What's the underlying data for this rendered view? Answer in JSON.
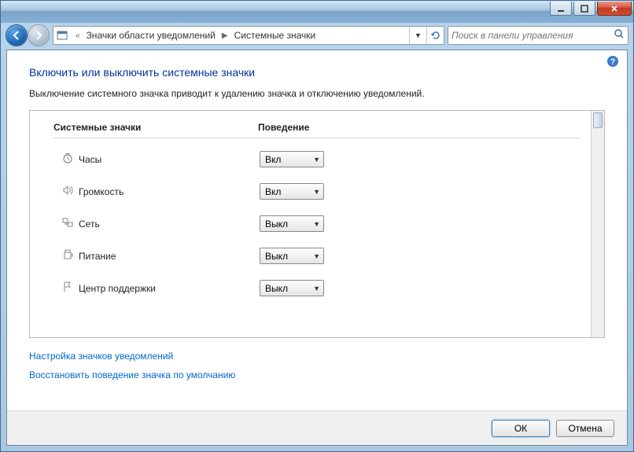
{
  "window": {
    "breadcrumb_prefix": "«",
    "breadcrumb_1": "Значки области уведомлений",
    "breadcrumb_2": "Системные значки"
  },
  "search": {
    "placeholder": "Поиск в панели управления"
  },
  "page": {
    "title": "Включить или выключить системные значки",
    "description": "Выключение системного значка приводит к удалению значка и отключению уведомлений."
  },
  "columns": {
    "c1": "Системные значки",
    "c2": "Поведение"
  },
  "options": {
    "on": "Вкл",
    "off": "Выкл"
  },
  "rows": [
    {
      "icon": "clock-icon",
      "label": "Часы",
      "value": "Вкл"
    },
    {
      "icon": "volume-icon",
      "label": "Громкость",
      "value": "Вкл"
    },
    {
      "icon": "network-icon",
      "label": "Сеть",
      "value": "Выкл"
    },
    {
      "icon": "power-icon",
      "label": "Питание",
      "value": "Выкл"
    },
    {
      "icon": "flag-icon",
      "label": "Центр поддержки",
      "value": "Выкл"
    }
  ],
  "links": {
    "customize": "Настройка значков уведомлений",
    "restore": "Восстановить поведение значка по умолчанию"
  },
  "buttons": {
    "ok": "ОК",
    "cancel": "Отмена"
  }
}
